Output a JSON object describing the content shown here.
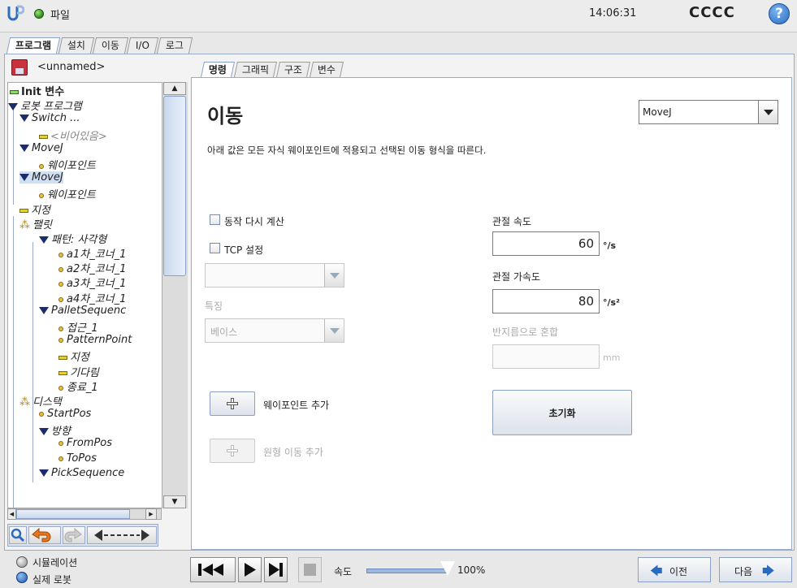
{
  "header": {
    "file_label": "파일",
    "clock": "14:06:31",
    "robot_name": "CCCC",
    "help_icon": "?"
  },
  "main_tabs": [
    "프로그램",
    "설치",
    "이동",
    "I/O",
    "로그"
  ],
  "program": {
    "name": "<unnamed>"
  },
  "tree": [
    {
      "label": "Init 변수",
      "bold": true
    },
    {
      "label": "로봇 프로그램"
    },
    {
      "label": "Switch ..."
    },
    {
      "label": "<비어있음>"
    },
    {
      "label": "MoveJ"
    },
    {
      "label": "웨이포인트"
    },
    {
      "label": "MoveJ",
      "selected": true
    },
    {
      "label": "웨이포인트"
    },
    {
      "label": "지정"
    },
    {
      "label": "팰릿"
    },
    {
      "label": "패턴: 사각형"
    },
    {
      "label": "a1차_코너_1"
    },
    {
      "label": "a2차_코너_1"
    },
    {
      "label": "a3차_코너_1"
    },
    {
      "label": "a4차_코너_1"
    },
    {
      "label": "PalletSequenc"
    },
    {
      "label": "접근_1"
    },
    {
      "label": "PatternPoint"
    },
    {
      "label": "지정"
    },
    {
      "label": "기다림"
    },
    {
      "label": "종료_1"
    },
    {
      "label": "디스택"
    },
    {
      "label": "StartPos"
    },
    {
      "label": "방향"
    },
    {
      "label": "FromPos"
    },
    {
      "label": "ToPos"
    },
    {
      "label": "PickSequence"
    }
  ],
  "sub_tabs": [
    "명령",
    "그래픽",
    "구조",
    "변수"
  ],
  "move": {
    "title": "이동",
    "move_type": "MoveJ",
    "description": "아래 값은 모든 자식 웨이포인트에 적용되고 선택된 이동 형식을 따른다.",
    "recalc_label": "동작 다시 계산",
    "tcp_label": "TCP 설정",
    "feature_label": "특징",
    "feature_value": "베이스",
    "joint_speed_label": "관절 속도",
    "joint_speed_value": "60",
    "joint_speed_unit": "°/s",
    "joint_accel_label": "관절 가속도",
    "joint_accel_value": "80",
    "joint_accel_unit": "°/s²",
    "blend_label": "반지름으로 혼합",
    "blend_unit": "mm",
    "add_waypoint_label": "웨이포인트 추가",
    "add_circle_label": "원형 이동 추가",
    "reset_label": "초기화"
  },
  "footer": {
    "sim_label": "시뮬레이션",
    "real_label": "실제 로봇",
    "speed_label": "속도",
    "speed_value": "100%",
    "speed_fraction": 1.0,
    "prev_label": "이전",
    "next_label": "다음"
  }
}
